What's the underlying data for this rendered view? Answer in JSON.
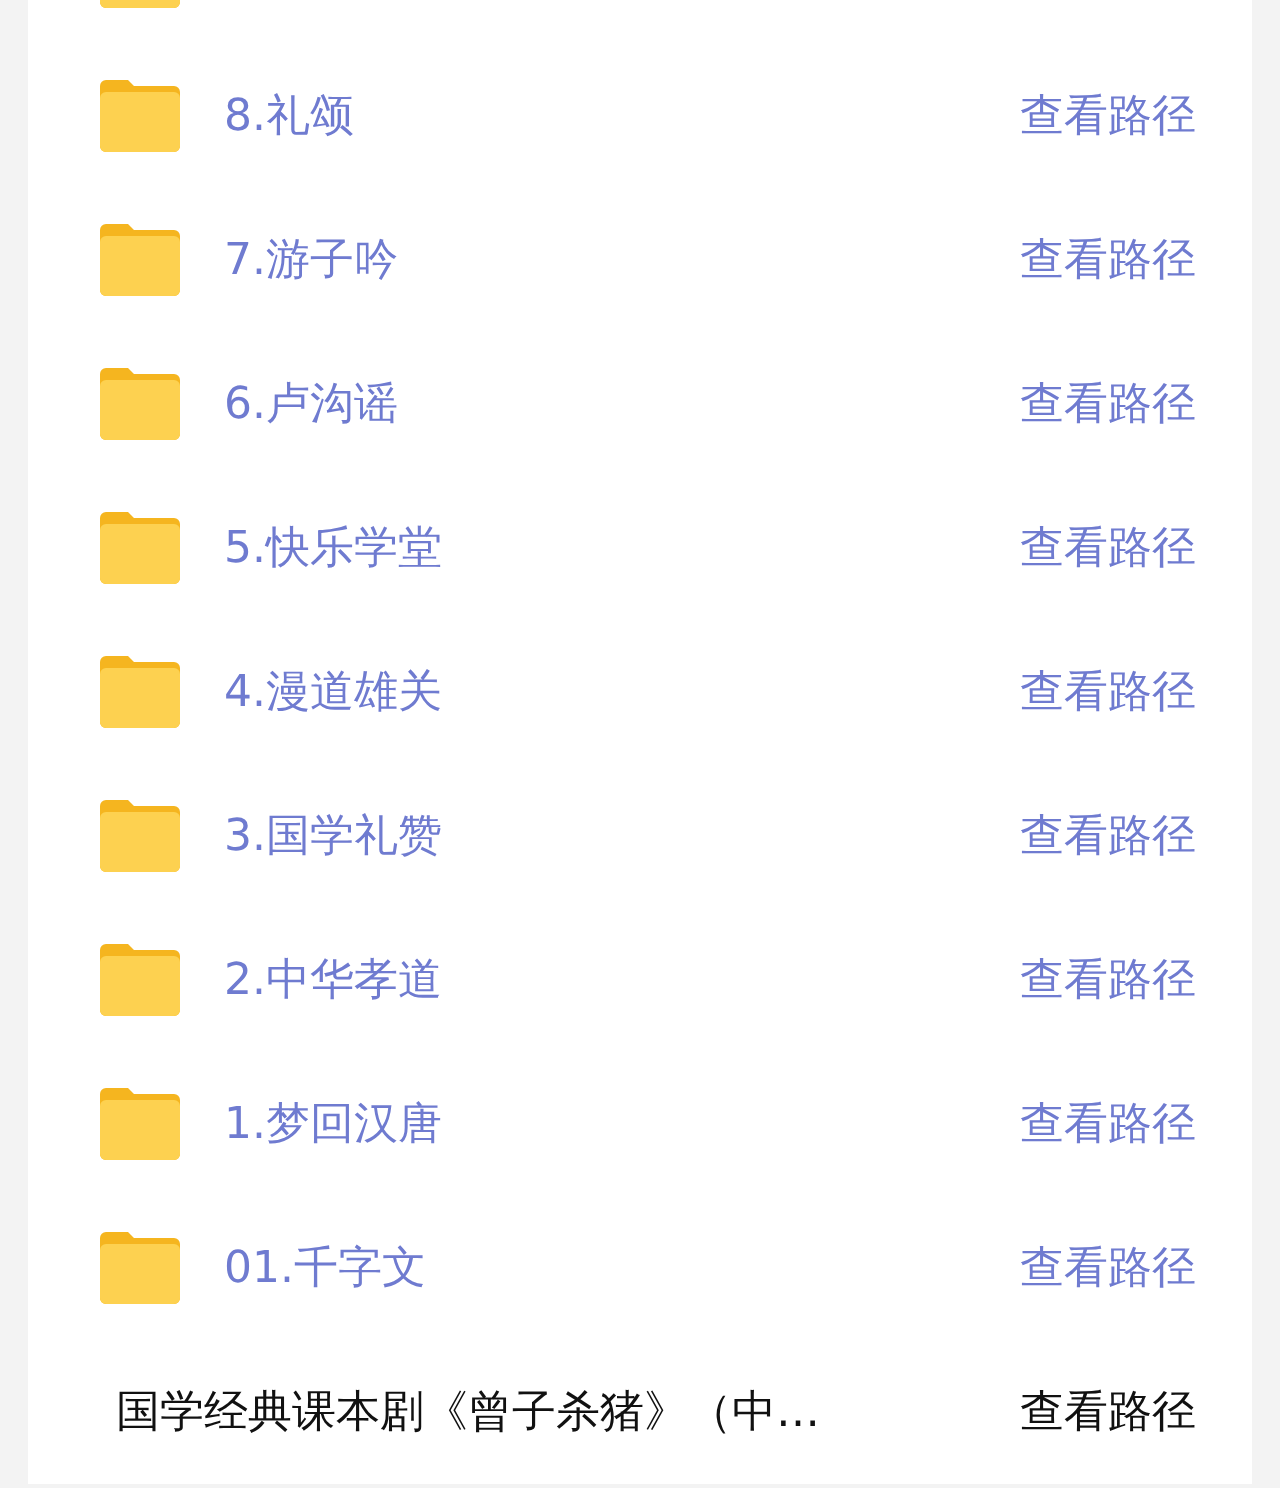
{
  "items": [
    {
      "kind": "cut"
    },
    {
      "kind": "folder",
      "name": "8.礼颂",
      "action": "查看路径"
    },
    {
      "kind": "folder",
      "name": "7.游子吟",
      "action": "查看路径"
    },
    {
      "kind": "folder",
      "name": "6.卢沟谣",
      "action": "查看路径"
    },
    {
      "kind": "folder",
      "name": "5.快乐学堂",
      "action": "查看路径"
    },
    {
      "kind": "folder",
      "name": "4.漫道雄关",
      "action": "查看路径"
    },
    {
      "kind": "folder",
      "name": "3.国学礼赞",
      "action": "查看路径"
    },
    {
      "kind": "folder",
      "name": "2.中华孝道",
      "action": "查看路径"
    },
    {
      "kind": "folder",
      "name": "1.梦回汉唐",
      "action": "查看路径"
    },
    {
      "kind": "folder",
      "name": "01.千字文",
      "action": "查看路径"
    },
    {
      "kind": "file",
      "name": "国学经典课本剧《曾子杀猪》（中…",
      "action": "查看路径"
    }
  ]
}
